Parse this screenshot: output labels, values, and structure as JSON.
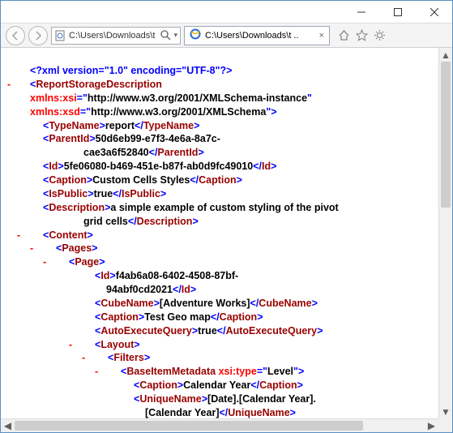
{
  "window": {
    "address": "C:\\Users\\Downloads\\t",
    "tab_title": "C:\\Users\\Downloads\\t ..",
    "search_icon_label": "Search"
  },
  "xml": {
    "declaration": "<?xml version=\"1.0\" encoding=\"UTF-8\"?>",
    "root": "ReportStorageDescription",
    "xsi_attr": "xmlns:xsi",
    "xsi_val": "http://www.w3.org/2001/XMLSchema-instance",
    "xsd_attr": "xmlns:xsd",
    "xsd_val": "http://www.w3.org/2001/XMLSchema",
    "typename_tag": "TypeName",
    "typename_val": "report",
    "parentid_tag": "ParentId",
    "parentid_val_l1": "50d6eb99-e7f3-4e6a-8a7c-",
    "parentid_val_l2": "cae3a6f52840",
    "id_tag": "Id",
    "id_val": "5fe06080-b469-451e-b87f-ab0d9fc49010",
    "caption_tag": "Caption",
    "caption_val": "Custom Cells Styles",
    "ispublic_tag": "IsPublic",
    "ispublic_val": "true",
    "desc_tag": "Description",
    "desc_val_l1": "a simple example of custom styling of the pivot",
    "desc_val_l2": "grid cells",
    "content_tag": "Content",
    "pages_tag": "Pages",
    "page_tag": "Page",
    "page_id_tag": "Id",
    "page_id_val_l1": "f4ab6a08-6402-4508-87bf-",
    "page_id_val_l2": "94abf0cd2021",
    "cubename_tag": "CubeName",
    "cubename_val": "[Adventure Works]",
    "page_caption_tag": "Caption",
    "page_caption_val": "Test Geo map",
    "autoexec_tag": "AutoExecuteQuery",
    "autoexec_val": "true",
    "layout_tag": "Layout",
    "filters_tag": "Filters",
    "baseitem_tag": "BaseItemMetadata",
    "baseitem_attr": "xsi:type",
    "baseitem_attr_val": "Level",
    "bi_caption_tag": "Caption",
    "bi_caption_val": "Calendar Year",
    "uniquename_tag": "UniqueName",
    "uniquename_val_l1": "[Date].[Calendar Year].",
    "uniquename_val_l2": "[Calendar Year]"
  }
}
